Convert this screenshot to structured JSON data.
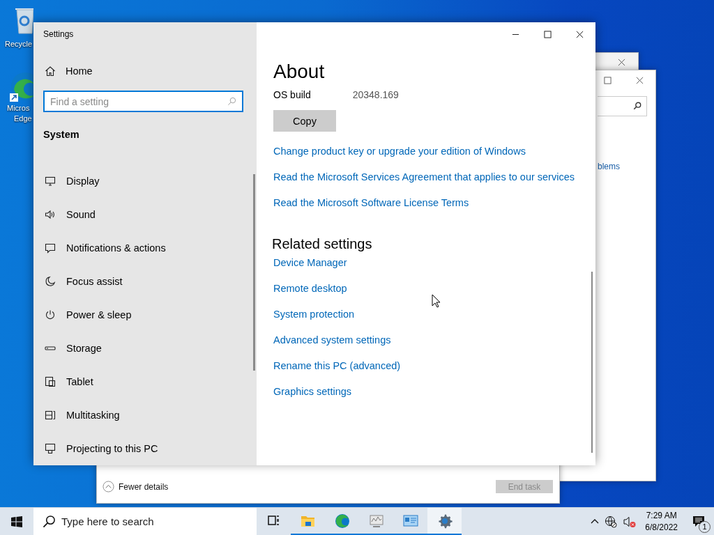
{
  "desktop_icons": [
    {
      "kind": "recycle-bin",
      "lines": [
        "Recycle"
      ]
    },
    {
      "kind": "edge",
      "lines": [
        "Micros",
        "Edge"
      ]
    }
  ],
  "background_windows": [
    {
      "kind": "titlebar-strip"
    },
    {
      "kind": "search-pane",
      "link": "blems"
    },
    {
      "kind": "task-manager",
      "toggle": "Fewer details",
      "button": {
        "label": "End task",
        "disabled": true
      }
    }
  ],
  "settings_window": {
    "title": "Settings",
    "sidebar": {
      "home": "Home",
      "search": {
        "placeholder": "Find a setting"
      },
      "section": "System",
      "items": [
        {
          "label": "Display",
          "kind": "display",
          "selected": false
        },
        {
          "label": "Sound",
          "kind": "sound",
          "selected": false
        },
        {
          "label": "Notifications & actions",
          "kind": "notifications",
          "selected": false
        },
        {
          "label": "Focus assist",
          "kind": "focus",
          "selected": false
        },
        {
          "label": "Power & sleep",
          "kind": "power",
          "selected": false
        },
        {
          "label": "Storage",
          "kind": "storage",
          "selected": false
        },
        {
          "label": "Tablet",
          "kind": "tablet",
          "selected": false
        },
        {
          "label": "Multitasking",
          "kind": "multitasking",
          "selected": false
        },
        {
          "label": "Projecting to this PC",
          "kind": "projecting",
          "selected": false
        }
      ]
    },
    "main": {
      "title": "About",
      "specs": [
        {
          "label": "OS build",
          "value": "20348.169"
        }
      ],
      "copy_button": "Copy",
      "links": [
        "Change product key or upgrade your edition of Windows",
        "Read the Microsoft Services Agreement that applies to our services",
        "Read the Microsoft Software License Terms"
      ],
      "related": {
        "title": "Related settings",
        "links": [
          "Device Manager",
          "Remote desktop",
          "System protection",
          "Advanced system settings",
          "Rename this PC (advanced)",
          "Graphics settings"
        ]
      }
    }
  },
  "taskbar": {
    "search": {
      "placeholder": "Type here to search"
    },
    "apps": [
      {
        "kind": "task-view",
        "running": false,
        "selected": false
      },
      {
        "kind": "file-explorer",
        "running": true,
        "selected": false
      },
      {
        "kind": "edge",
        "running": true,
        "selected": false
      },
      {
        "kind": "performance-monitor",
        "running": true,
        "selected": false
      },
      {
        "kind": "system-information",
        "running": true,
        "selected": false
      },
      {
        "kind": "settings",
        "running": true,
        "selected": true
      }
    ],
    "tray": {
      "time": "7:29 AM",
      "date": "6/8/2022",
      "notifications": "1"
    }
  }
}
